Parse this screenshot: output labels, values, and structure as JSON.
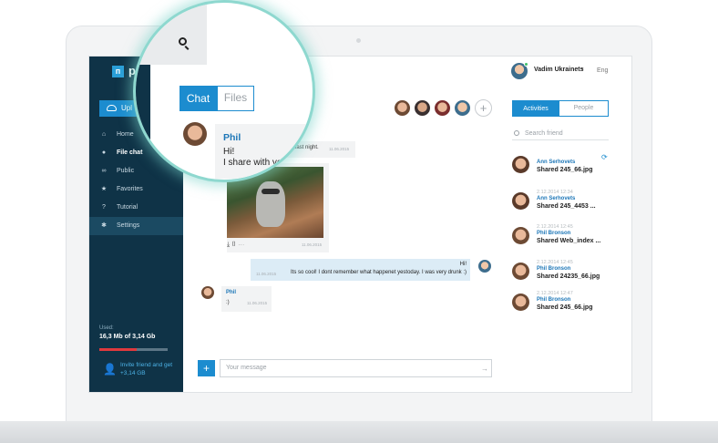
{
  "app": {
    "logo_mark": "п",
    "logo_text": "pi"
  },
  "sidebar": {
    "upload_label": "Upl",
    "items": [
      {
        "label": "Home",
        "icon": "home-icon",
        "glyph": "⌂"
      },
      {
        "label": "File chat",
        "icon": "chat-icon",
        "glyph": "●"
      },
      {
        "label": "Public",
        "icon": "link-icon",
        "glyph": "∞"
      },
      {
        "label": "Favorites",
        "icon": "star-icon",
        "glyph": "★"
      },
      {
        "label": "Tutorial",
        "icon": "question-icon",
        "glyph": "?"
      },
      {
        "label": "Settings",
        "icon": "gear-icon",
        "glyph": "✱"
      }
    ],
    "used_label": "Used:",
    "used_value": "16,3 Mb of 3,14 Gb",
    "used_fraction": 0.55,
    "invite_text": "Invite friend and get +3,14 GB"
  },
  "header": {
    "user_name": "Vadim Ukrainets",
    "caret": "▾",
    "language": "Eng"
  },
  "magnifier": {
    "tab_chat": "Chat",
    "tab_files": "Files",
    "author": "Phil",
    "line1": "Hi!",
    "line2": "I share with you"
  },
  "chat": {
    "partial_text": "last night.",
    "msg_time_a": "11.06.2015",
    "image_time": "11.06.2015",
    "image_tools": "⤓  ▯  ⋯",
    "my_author": "Hi!",
    "my_text": "Its so cool! I dont remember what happenet yestoday. I was very drunk :)",
    "my_time": "11.06.2015",
    "phil_name": "Phil",
    "phil_text": ":)",
    "phil_time": "11.06.2015",
    "add_participant": "+",
    "composer_plus": "+",
    "composer_placeholder": "Your message",
    "send_glyph": "→"
  },
  "right_panel": {
    "tab_activities": "Activities",
    "tab_people": "People",
    "search_placeholder": "Search friend",
    "refresh_glyph": "⟳",
    "activities": [
      {
        "date": "",
        "name": "Ann Serhovets",
        "file": "Shared 245_66.jpg"
      },
      {
        "date": "2.12.2014 12:34",
        "name": "Ann Serhovets",
        "file": "Shared 245_4453 ..."
      },
      {
        "date": "2.12.2014 12:45",
        "name": "Phil Bronson",
        "file": "Shared Web_index ..."
      },
      {
        "date": "2.12.2014 12:45",
        "name": "Phil Bronson",
        "file": "Shared 24235_66.jpg"
      },
      {
        "date": "2.12.2014 12:47",
        "name": "Phil Bronson",
        "file": "Shared 245_66.jpg"
      }
    ]
  },
  "colors": {
    "accent": "#1c8ccf",
    "sidebar_bg": "#0f3347",
    "magnifier_glow": "#8ed8cf",
    "storage_bar": "#e0393d"
  }
}
